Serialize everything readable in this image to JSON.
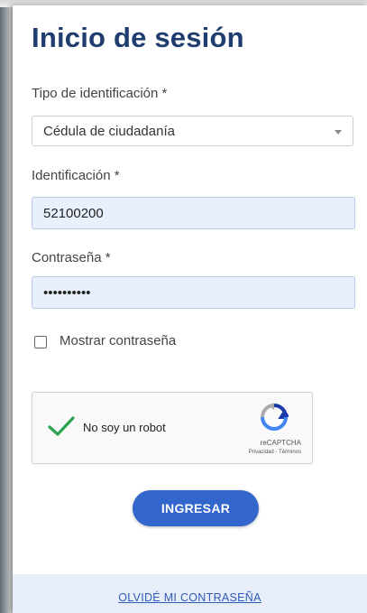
{
  "title": "Inicio de sesión",
  "id_type": {
    "label": "Tipo de identificación *",
    "selected": "Cédula de ciudadanía"
  },
  "identification": {
    "label": "Identificación *",
    "value": "52100200"
  },
  "password": {
    "label": "Contraseña *",
    "value": "••••••••••"
  },
  "show_password": {
    "label": "Mostrar contraseña",
    "checked": false
  },
  "captcha": {
    "text": "No soy un robot",
    "brand": "reCAPTCHA",
    "terms": "Privacidad - Términos",
    "checked": true,
    "check_color": "#2aa44f"
  },
  "submit_label": "INGRESAR",
  "forgot_password_link": "OLVIDÉ MI CONTRASEÑA",
  "colors": {
    "title": "#1f3d6f",
    "primary_button": "#3366cc",
    "autofill_bg": "#e8f0fe",
    "link": "#2d5bb8"
  },
  "icons": [
    "chevron-down-icon",
    "checkmark-icon",
    "recaptcha-logo-icon"
  ]
}
